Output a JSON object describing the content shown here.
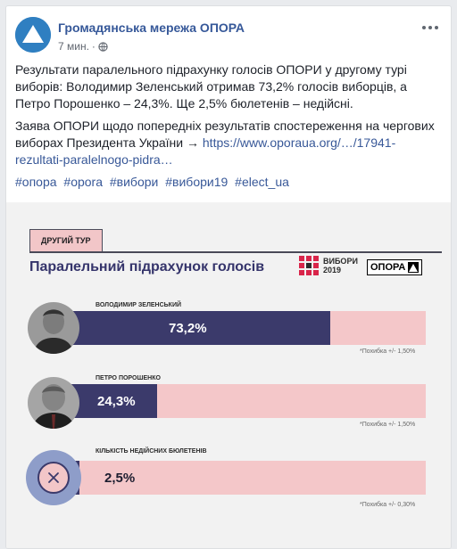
{
  "post": {
    "page_name": "Громадянська мережа ОПОРА",
    "time": "7 мин.",
    "separator": "·",
    "paragraph1": "Результати паралельного підрахунку голосів ОПОРИ у другому турі виборів: Володимир Зеленський отримав 73,2% голосів виборців, а Петро Порошенко – 24,3%. Ще 2,5% бюлетенів – недійсні.",
    "paragraph2_text": "Заява ОПОРИ щодо попередніх результатів спостереження на чергових виборах Президента України → ",
    "paragraph2_link": "https://www.oporaua.org/…/17941-rezultati-paralelnogo-pidra…",
    "hashtags": [
      "#опора",
      "#opora",
      "#вибори",
      "#вибори19",
      "#elect_ua"
    ]
  },
  "infographic": {
    "badge": "ДРУГИЙ ТУР",
    "title": "Паралельний підрахунок голосів",
    "brand_line1": "ВИБОРИ",
    "brand_line2": "2019",
    "logo": "ОПОРА",
    "colors": {
      "fill": "#3b3a6b",
      "track": "#f4c7c9",
      "title": "#35346b"
    }
  },
  "chart_data": {
    "type": "bar",
    "title": "Паралельний підрахунок голосів",
    "categories": [
      "ВОЛОДИМИР ЗЕЛЕНСЬКИЙ",
      "ПЕТРО ПОРОШЕНКО",
      "КІЛЬКІСТЬ НЕДІЙСНИХ БЮЛЕТЕНІВ"
    ],
    "values": [
      73.2,
      24.3,
      2.5
    ],
    "value_labels": [
      "73,2%",
      "24,3%",
      "2,5%"
    ],
    "margins": [
      "*Похибка +/- 1,50%",
      "*Похибка +/- 1,50%",
      "*Похибка +/- 0,30%"
    ],
    "ylim": [
      0,
      100
    ],
    "icons": [
      "zelensky-photo",
      "poroshenko-photo",
      "invalid-ballot-icon"
    ]
  }
}
